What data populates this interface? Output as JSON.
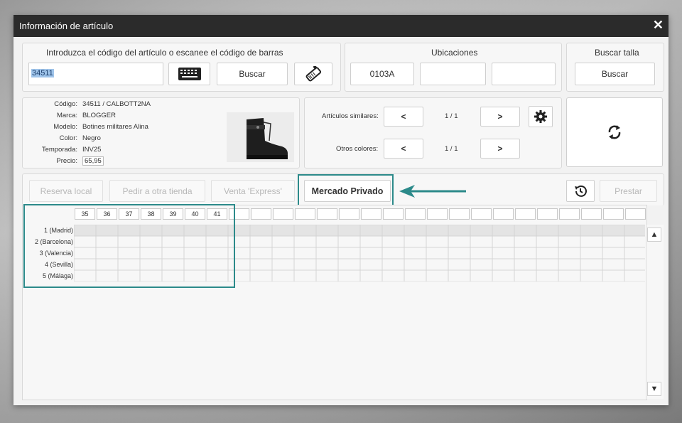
{
  "window": {
    "title": "Información de artículo",
    "close": "✕"
  },
  "search": {
    "label": "Introduzca el código del artículo o escanee el código de barras",
    "value": "34511",
    "button": "Buscar",
    "keyboard_icon": "keyboard-icon",
    "scan_icon": "scanner-icon"
  },
  "locations": {
    "label": "Ubicaciones",
    "items": [
      "0103A",
      "",
      ""
    ]
  },
  "size_search": {
    "label": "Buscar talla",
    "button": "Buscar"
  },
  "article": {
    "fields": [
      {
        "k": "Código:",
        "v": "34511 / CALBOTT2NA"
      },
      {
        "k": "Marca:",
        "v": "BLOGGER"
      },
      {
        "k": "Modelo:",
        "v": "Botines militares Alina"
      },
      {
        "k": "Color:",
        "v": "Negro"
      },
      {
        "k": "Temporada:",
        "v": "INV25"
      },
      {
        "k": "Precio:",
        "v": "65,95"
      }
    ],
    "image_icon": "boot-image"
  },
  "similar": {
    "label": "Artículos similares:",
    "page": "1 / 1",
    "prev": "<",
    "next": ">"
  },
  "colors": {
    "label": "Otros colores:",
    "page": "1 / 1",
    "prev": "<",
    "next": ">"
  },
  "actions": {
    "reserva": "Reserva local",
    "pedir": "Pedir a otra tienda",
    "venta": "Venta 'Express'",
    "mercado": "Mercado Privado",
    "prestar": "Prestar"
  },
  "sizes": [
    "35",
    "36",
    "37",
    "38",
    "39",
    "40",
    "41"
  ],
  "stores": [
    "1 (Madrid)",
    "2 (Barcelona)",
    "3 (Valencia)",
    "4 (Sevilla)",
    "5 (Málaga)"
  ],
  "scroll": {
    "up": "▲",
    "down": "▼"
  },
  "colors_theme": {
    "accent": "#2c8a8a",
    "titlebar": "#2b2b2b"
  }
}
